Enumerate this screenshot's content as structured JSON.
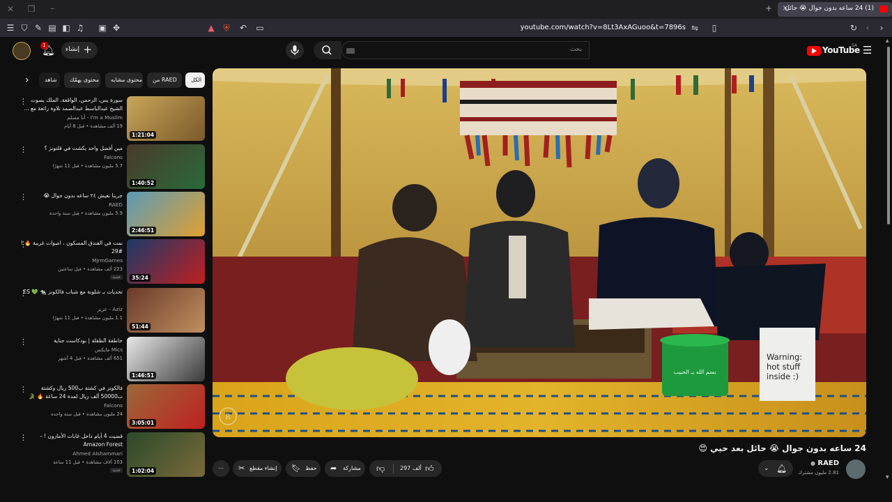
{
  "browser": {
    "tab_title": "(1) 24 ساعه بدون جوال 😭 حائل",
    "url": "youtube.com/watch?v=8Lt3AxAGuoo&t=7896s"
  },
  "header": {
    "search_placeholder": "بحث",
    "create_label": "إنشاء",
    "notif_count": "1",
    "logo_text": "YouTube",
    "logo_region": "SA"
  },
  "chips": [
    {
      "label": "الكل"
    },
    {
      "label": "من RAED"
    },
    {
      "label": "محتوى مشابه"
    },
    {
      "label": "محتوى يهمّك"
    },
    {
      "label": "شاهد"
    }
  ],
  "recommendations": [
    {
      "title": "سورة يس، الرحمن، الواقعة، الملك بصوت الشيخ عبدالباسط عبدالصمد تلاوة رائعة مع ...",
      "channel": "I'm a Muslim - أنا مسلم",
      "meta": "19 ألف مشاهدة • قبل 8 أيام",
      "duration": "1:21:04",
      "badge": ""
    },
    {
      "title": "مين أفضل واحد يكشت في قلتونز ؟",
      "channel": "Falcons",
      "meta": "5.7 مليون مشاهدة • قبل 11 شهرًا",
      "duration": "1:40:52",
      "badge": ""
    },
    {
      "title": "جربنا نعيش ٢٤ ساعه بدون جوال 😭",
      "channel": "RAED",
      "meta": "5.9 مليون مشاهدة • قبل سنة واحدة",
      "duration": "2:46:51",
      "badge": ""
    },
    {
      "title": "نمت في الفندق المسكون ، اصوات غريبة 🔥 ! #29",
      "channel": "MjrmGames",
      "meta": "223 ألف مشاهدة • قبل ساعتين",
      "duration": "35:24",
      "badge": "جديد"
    },
    {
      "title": "تحديات بـ شلونة مع شباب فالكونز 🐀 💚 ES",
      "channel": "Aziz - عزيز",
      "meta": "1.1 مليون مشاهدة • قبل 11 شهرًا",
      "duration": "51:44",
      "badge": ""
    },
    {
      "title": "خاطفة الطفلة | بودكاست جناية",
      "channel": "Mics مايكس",
      "meta": "651 ألف مشاهدة • قبل 4 أشهر",
      "duration": "1:46:51",
      "badge": ""
    },
    {
      "title": "فالكونز في كشتة ب500 ريال وكشتة ب50000 ألف ريال لمدة 24 ساعة 🔥 🐊",
      "channel": "Falcons",
      "meta": "24 مليون مشاهدة • قبل سنة واحدة",
      "duration": "3:05:01",
      "badge": ""
    },
    {
      "title": "قضيت 4 أيام داخل غابات الأمازون ! - Amazon Forest",
      "channel": "Ahmed Alshammari",
      "meta": "103 آلاف مشاهدة • قبل 11 ساعة",
      "duration": "1:02:04",
      "badge": "جديد"
    }
  ],
  "video": {
    "title": "24 ساعه بدون جوال 😭 حائل بعد حيي 😍",
    "channel_name": "RAED",
    "subscribers": "2.81 مليون مشترك",
    "likes": "297 ألف",
    "share_label": "مشاركة",
    "save_label": "حفظ",
    "clip_label": "إنشاء مقطع",
    "sign_text": "Warning: hot stuff inside :)",
    "bucket_text": "بسم الله يـ الحبيب",
    "watermark": "R"
  },
  "colors": {
    "bg": "#0f0f0f",
    "chip": "#272727",
    "yt_red": "#ff0000",
    "tent": "#c8a44c"
  }
}
